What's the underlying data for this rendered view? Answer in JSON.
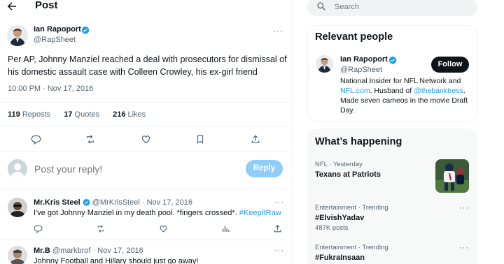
{
  "header": {
    "title": "Post"
  },
  "tweet": {
    "author_name": "Ian Rapoport",
    "author_handle": "@RapSheet",
    "text": "Per AP, Johnny Manziel reached a deal with prosecutors for dismissal of his domestic assault case with Colleen Crowley, his ex-girl friend",
    "time": "10:00 PM · Nov 17, 2016",
    "stats": {
      "reposts_count": "119",
      "reposts_label": "Reposts",
      "quotes_count": "17",
      "quotes_label": "Quotes",
      "likes_count": "216",
      "likes_label": "Likes"
    },
    "more": "···"
  },
  "reply_box": {
    "placeholder": "Post your reply!",
    "button_label": "Reply"
  },
  "replies": [
    {
      "name": "Mr.Kris Steel",
      "handle": "@MrKrisSteel",
      "date": "· Nov 17, 2016",
      "text": "I've got Johnny Manziel in my death pool. *fingers crossed*.",
      "hashtag": "#KeepItRaw",
      "more": "···"
    },
    {
      "name": "Mr.B",
      "handle": "@markbrof",
      "date": "· Nov 17, 2016",
      "text": "Johnny Football and Hillary should just go away!",
      "more": "···"
    }
  ],
  "search": {
    "placeholder": "Search"
  },
  "relevant_people": {
    "title": "Relevant people",
    "name": "Ian Rapoport",
    "handle": "@RapSheet",
    "follow_label": "Follow",
    "bio_1": "National Insider for NFL Network and",
    "bio_link_1": "NFL.com",
    "bio_2": ". Husband of",
    "bio_link_2": "@thebanktress",
    "bio_3": ". Made seven cameos in the movie Draft Day."
  },
  "whats_happening": {
    "title": "What’s happening",
    "trends": [
      {
        "category": "NFL · Yesterday",
        "name": "Texans at Patriots"
      },
      {
        "category": "Entertainment · Trending",
        "name": "#ElvishYadav",
        "count": "487K posts",
        "more": "···"
      },
      {
        "category": "Entertainment · Trending",
        "name": "#FukraInsaan",
        "more": "···"
      }
    ]
  },
  "colors": {
    "accent": "#1d9bf0",
    "text": "#0f1419",
    "muted": "#536471",
    "reply_button": "#8ecdf8"
  }
}
